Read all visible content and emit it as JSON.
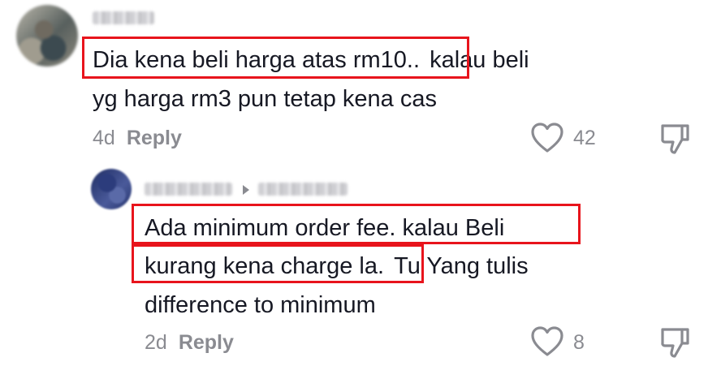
{
  "comment1": {
    "line1_highlight": "Dia kena beli harga atas rm10..",
    "line1_rest": "kalau beli",
    "line2": "yg harga rm3 pun tetap kena cas",
    "age": "4d",
    "reply_label": "Reply",
    "like_count": "42",
    "like_icon": "heart-outline-icon",
    "dislike_icon": "thumbs-down-icon"
  },
  "reply1": {
    "line1_highlight": "Ada minimum order fee. kalau Beli",
    "line2_highlight": "kurang kena charge la.",
    "line2_rest": "Tu Yang tulis",
    "line3": "difference to minimum",
    "age": "2d",
    "reply_label": "Reply",
    "like_count": "8",
    "like_icon": "heart-outline-icon",
    "dislike_icon": "thumbs-down-icon"
  },
  "colors": {
    "highlight": "#e8141c",
    "text": "#161823",
    "muted": "#8a8b91"
  }
}
